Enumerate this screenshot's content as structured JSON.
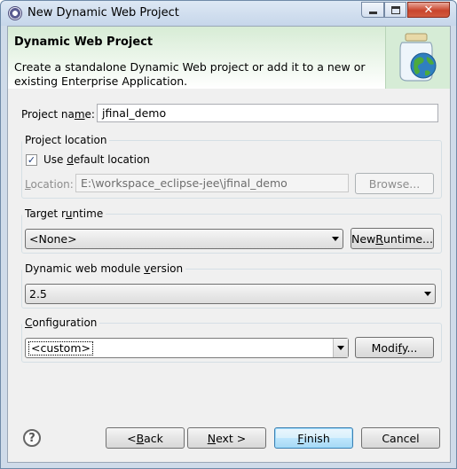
{
  "window": {
    "title": "New Dynamic Web Project",
    "close_glyph": "✕"
  },
  "banner": {
    "title": "Dynamic Web Project",
    "description": "Create a standalone Dynamic Web project or add it to a new or existing Enterprise Application.",
    "icon": "globe-jar-icon"
  },
  "project_name": {
    "label_pre": "Project na",
    "label_mnemonic": "m",
    "label_post": "e:",
    "value": "jfinal_demo"
  },
  "project_location": {
    "title": "Project location",
    "use_default_pre": "Use ",
    "use_default_mnemonic": "d",
    "use_default_post": "efault location",
    "use_default_checked": true,
    "check_glyph": "✓",
    "location_mnemonic": "L",
    "location_post": "ocation:",
    "location_value": "E:\\workspace_eclipse-jee\\jfinal_demo",
    "browse_label": "Browse..."
  },
  "target_runtime": {
    "title_pre": "Target r",
    "title_mnemonic": "u",
    "title_post": "ntime",
    "selected": "<None>",
    "new_runtime_pre": "New ",
    "new_runtime_mnemonic": "R",
    "new_runtime_post": "untime..."
  },
  "module_version": {
    "title_pre": "Dynamic web module ",
    "title_mnemonic": "v",
    "title_post": "ersion",
    "selected": "2.5"
  },
  "configuration": {
    "title_mnemonic": "C",
    "title_post": "onfiguration",
    "selected": "<custom>",
    "modify_pre": "Modi",
    "modify_mnemonic": "f",
    "modify_post": "y..."
  },
  "footer": {
    "help_glyph": "?",
    "back_pre": "< ",
    "back_mnemonic": "B",
    "back_post": "ack",
    "next_mnemonic": "N",
    "next_post": "ext >",
    "finish_mnemonic": "F",
    "finish_post": "inish",
    "cancel_label": "Cancel"
  },
  "colors": {
    "banner_green": "#d6ecd6",
    "default_button_border": "#3c7fb1",
    "close_button_red": "#c9452c"
  }
}
